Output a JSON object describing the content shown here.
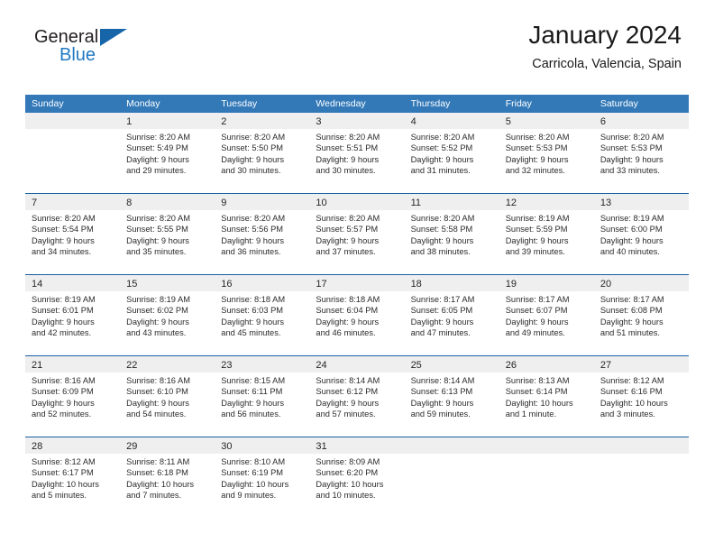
{
  "logo": {
    "word_one": "General",
    "word_two": "Blue",
    "flag_icon": "triangle-flag-icon"
  },
  "header": {
    "title": "January 2024",
    "location": "Carricola, Valencia, Spain"
  },
  "colors": {
    "header_blue": "#3379b8",
    "row_divider_blue": "#1a5fa0",
    "day_band_gray": "#efefef",
    "logo_blue": "#2079c4",
    "text": "#1a1a1a"
  },
  "weekdays": [
    "Sunday",
    "Monday",
    "Tuesday",
    "Wednesday",
    "Thursday",
    "Friday",
    "Saturday"
  ],
  "weeks": [
    [
      {
        "day": "",
        "sunrise": "",
        "sunset": "",
        "daylight_1": "",
        "daylight_2": "",
        "empty": true
      },
      {
        "day": "1",
        "sunrise": "Sunrise: 8:20 AM",
        "sunset": "Sunset: 5:49 PM",
        "daylight_1": "Daylight: 9 hours",
        "daylight_2": "and 29 minutes."
      },
      {
        "day": "2",
        "sunrise": "Sunrise: 8:20 AM",
        "sunset": "Sunset: 5:50 PM",
        "daylight_1": "Daylight: 9 hours",
        "daylight_2": "and 30 minutes."
      },
      {
        "day": "3",
        "sunrise": "Sunrise: 8:20 AM",
        "sunset": "Sunset: 5:51 PM",
        "daylight_1": "Daylight: 9 hours",
        "daylight_2": "and 30 minutes."
      },
      {
        "day": "4",
        "sunrise": "Sunrise: 8:20 AM",
        "sunset": "Sunset: 5:52 PM",
        "daylight_1": "Daylight: 9 hours",
        "daylight_2": "and 31 minutes."
      },
      {
        "day": "5",
        "sunrise": "Sunrise: 8:20 AM",
        "sunset": "Sunset: 5:53 PM",
        "daylight_1": "Daylight: 9 hours",
        "daylight_2": "and 32 minutes."
      },
      {
        "day": "6",
        "sunrise": "Sunrise: 8:20 AM",
        "sunset": "Sunset: 5:53 PM",
        "daylight_1": "Daylight: 9 hours",
        "daylight_2": "and 33 minutes."
      }
    ],
    [
      {
        "day": "7",
        "sunrise": "Sunrise: 8:20 AM",
        "sunset": "Sunset: 5:54 PM",
        "daylight_1": "Daylight: 9 hours",
        "daylight_2": "and 34 minutes."
      },
      {
        "day": "8",
        "sunrise": "Sunrise: 8:20 AM",
        "sunset": "Sunset: 5:55 PM",
        "daylight_1": "Daylight: 9 hours",
        "daylight_2": "and 35 minutes."
      },
      {
        "day": "9",
        "sunrise": "Sunrise: 8:20 AM",
        "sunset": "Sunset: 5:56 PM",
        "daylight_1": "Daylight: 9 hours",
        "daylight_2": "and 36 minutes."
      },
      {
        "day": "10",
        "sunrise": "Sunrise: 8:20 AM",
        "sunset": "Sunset: 5:57 PM",
        "daylight_1": "Daylight: 9 hours",
        "daylight_2": "and 37 minutes."
      },
      {
        "day": "11",
        "sunrise": "Sunrise: 8:20 AM",
        "sunset": "Sunset: 5:58 PM",
        "daylight_1": "Daylight: 9 hours",
        "daylight_2": "and 38 minutes."
      },
      {
        "day": "12",
        "sunrise": "Sunrise: 8:19 AM",
        "sunset": "Sunset: 5:59 PM",
        "daylight_1": "Daylight: 9 hours",
        "daylight_2": "and 39 minutes."
      },
      {
        "day": "13",
        "sunrise": "Sunrise: 8:19 AM",
        "sunset": "Sunset: 6:00 PM",
        "daylight_1": "Daylight: 9 hours",
        "daylight_2": "and 40 minutes."
      }
    ],
    [
      {
        "day": "14",
        "sunrise": "Sunrise: 8:19 AM",
        "sunset": "Sunset: 6:01 PM",
        "daylight_1": "Daylight: 9 hours",
        "daylight_2": "and 42 minutes."
      },
      {
        "day": "15",
        "sunrise": "Sunrise: 8:19 AM",
        "sunset": "Sunset: 6:02 PM",
        "daylight_1": "Daylight: 9 hours",
        "daylight_2": "and 43 minutes."
      },
      {
        "day": "16",
        "sunrise": "Sunrise: 8:18 AM",
        "sunset": "Sunset: 6:03 PM",
        "daylight_1": "Daylight: 9 hours",
        "daylight_2": "and 45 minutes."
      },
      {
        "day": "17",
        "sunrise": "Sunrise: 8:18 AM",
        "sunset": "Sunset: 6:04 PM",
        "daylight_1": "Daylight: 9 hours",
        "daylight_2": "and 46 minutes."
      },
      {
        "day": "18",
        "sunrise": "Sunrise: 8:17 AM",
        "sunset": "Sunset: 6:05 PM",
        "daylight_1": "Daylight: 9 hours",
        "daylight_2": "and 47 minutes."
      },
      {
        "day": "19",
        "sunrise": "Sunrise: 8:17 AM",
        "sunset": "Sunset: 6:07 PM",
        "daylight_1": "Daylight: 9 hours",
        "daylight_2": "and 49 minutes."
      },
      {
        "day": "20",
        "sunrise": "Sunrise: 8:17 AM",
        "sunset": "Sunset: 6:08 PM",
        "daylight_1": "Daylight: 9 hours",
        "daylight_2": "and 51 minutes."
      }
    ],
    [
      {
        "day": "21",
        "sunrise": "Sunrise: 8:16 AM",
        "sunset": "Sunset: 6:09 PM",
        "daylight_1": "Daylight: 9 hours",
        "daylight_2": "and 52 minutes."
      },
      {
        "day": "22",
        "sunrise": "Sunrise: 8:16 AM",
        "sunset": "Sunset: 6:10 PM",
        "daylight_1": "Daylight: 9 hours",
        "daylight_2": "and 54 minutes."
      },
      {
        "day": "23",
        "sunrise": "Sunrise: 8:15 AM",
        "sunset": "Sunset: 6:11 PM",
        "daylight_1": "Daylight: 9 hours",
        "daylight_2": "and 56 minutes."
      },
      {
        "day": "24",
        "sunrise": "Sunrise: 8:14 AM",
        "sunset": "Sunset: 6:12 PM",
        "daylight_1": "Daylight: 9 hours",
        "daylight_2": "and 57 minutes."
      },
      {
        "day": "25",
        "sunrise": "Sunrise: 8:14 AM",
        "sunset": "Sunset: 6:13 PM",
        "daylight_1": "Daylight: 9 hours",
        "daylight_2": "and 59 minutes."
      },
      {
        "day": "26",
        "sunrise": "Sunrise: 8:13 AM",
        "sunset": "Sunset: 6:14 PM",
        "daylight_1": "Daylight: 10 hours",
        "daylight_2": "and 1 minute."
      },
      {
        "day": "27",
        "sunrise": "Sunrise: 8:12 AM",
        "sunset": "Sunset: 6:16 PM",
        "daylight_1": "Daylight: 10 hours",
        "daylight_2": "and 3 minutes."
      }
    ],
    [
      {
        "day": "28",
        "sunrise": "Sunrise: 8:12 AM",
        "sunset": "Sunset: 6:17 PM",
        "daylight_1": "Daylight: 10 hours",
        "daylight_2": "and 5 minutes."
      },
      {
        "day": "29",
        "sunrise": "Sunrise: 8:11 AM",
        "sunset": "Sunset: 6:18 PM",
        "daylight_1": "Daylight: 10 hours",
        "daylight_2": "and 7 minutes."
      },
      {
        "day": "30",
        "sunrise": "Sunrise: 8:10 AM",
        "sunset": "Sunset: 6:19 PM",
        "daylight_1": "Daylight: 10 hours",
        "daylight_2": "and 9 minutes."
      },
      {
        "day": "31",
        "sunrise": "Sunrise: 8:09 AM",
        "sunset": "Sunset: 6:20 PM",
        "daylight_1": "Daylight: 10 hours",
        "daylight_2": "and 10 minutes."
      },
      {
        "day": "",
        "sunrise": "",
        "sunset": "",
        "daylight_1": "",
        "daylight_2": "",
        "empty": true
      },
      {
        "day": "",
        "sunrise": "",
        "sunset": "",
        "daylight_1": "",
        "daylight_2": "",
        "empty": true
      },
      {
        "day": "",
        "sunrise": "",
        "sunset": "",
        "daylight_1": "",
        "daylight_2": "",
        "empty": true
      }
    ]
  ]
}
